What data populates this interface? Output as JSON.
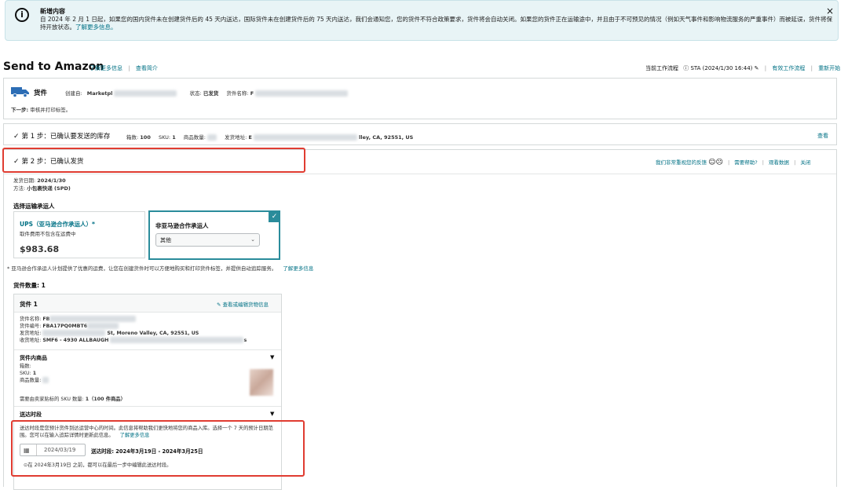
{
  "banner": {
    "icon": "info-icon",
    "title": "新增内容",
    "text": "自 2024 年 2 月 1 日起，如果您的国内货件未在创建货件后的 45 天内送达，国际货件未在创建货件后的 75 天内送达，我们会通知您，您的货件不符合政策要求，货件将会自动关闭。如果您的货件正在运输途中，并且由于不可预见的情况（例如天气事件和影响物流服务的严重事件）而被延误，货件将保持开放状态。",
    "link": "了解更多信息。",
    "close": "×"
  },
  "header": {
    "title": "Send to Amazon",
    "learn_more": "了解更多信息",
    "separator": "|",
    "view_intro": "查看简介",
    "workflow_label": "当前工作流程",
    "workflow_value": "STA (2024/1/30 16:44)",
    "valid_workflows": "有效工作流程",
    "restart": "重新开始"
  },
  "shipment": {
    "label": "货件",
    "created_from_label": "创建自:",
    "created_from_value": "Marketpl",
    "status_label": "状态:",
    "status_value": "已发货",
    "name_label": "货件名称:",
    "name_value": "F",
    "next_step_label": "下一步:",
    "next_step_value": "审核并打印标签。"
  },
  "step1": {
    "check": "✓",
    "title": "第 1 步：已确认要发送的库存",
    "boxes_label": "箱数:",
    "boxes_value": "100",
    "sku_label": "SKU:",
    "sku_value": "1",
    "qty_label": "商品数量:",
    "from_label": "发货地址:",
    "from_prefix": "E",
    "from_suffix": "lley, CA, 92551, US",
    "view": "查看"
  },
  "step2": {
    "check": "✓",
    "title": "第 2 步：已确认发货",
    "feedback": "我们非常重视您的反馈",
    "help": "需要帮助?",
    "view_data": "观看数据",
    "close": "关闭",
    "ship_date_label": "发货日期:",
    "ship_date_value": "2024/1/30",
    "method_label": "方法:",
    "method_value": "小包裹快递 (SPD)",
    "select_carrier": "选择运输承运人",
    "ups_title": "UPS（亚马逊合作承运人）*",
    "ups_sub": "取件费用不包含在运费中",
    "ups_price": "$983.68",
    "non_partner_title": "非亚马逊合作承运人",
    "non_partner_option": "其他",
    "note": "* 亚马逊合作承运人计划提供了优惠的运费，让您在创建货件时可以方便地购买和打印货件标签，并提供自动追踪服务。",
    "note_link": "了解更多信息",
    "shipment_count_label": "货件数量:",
    "shipment_count_value": "1"
  },
  "shipment1": {
    "title": "货件 1",
    "edit_link": "查看或编辑货物信息",
    "name_label": "货件名称:",
    "name_value": "FB",
    "id_label": "货件编号:",
    "id_value": "FBA17PQ0MBT6",
    "from_label": "发货地址:",
    "from_value": "St, Moreno Valley, CA, 92551, US",
    "to_label": "收货地址:",
    "to_value": "SMF6 - 4930 ALLBAUGH",
    "to_suffix": "s",
    "contents_title": "货件内商品",
    "boxes_label": "箱数:",
    "sku_label": "SKU:",
    "sku_value": "1",
    "qty_label": "商品数量:",
    "label_note_prefix": "需要由卖家贴标的 SKU 数量:",
    "label_note_value": "1（100 件商品）",
    "window_title": "送达时段",
    "window_desc": "送达时段是您预计货件到达运营中心的时间。此信息将帮助我们更快地将您的商品入库。选择一个 7 天的预计日期范围。您可以在输入追踪详情时更新此信息。",
    "window_link": "了解更多信息",
    "date_value": "2024/03/19",
    "window_range": "送达时段: 2024年3月19日 - 2024年3月25日",
    "window_hint": "在 2024年3月19日 之前，都可以在最后一步中编辑此送达时段。"
  }
}
